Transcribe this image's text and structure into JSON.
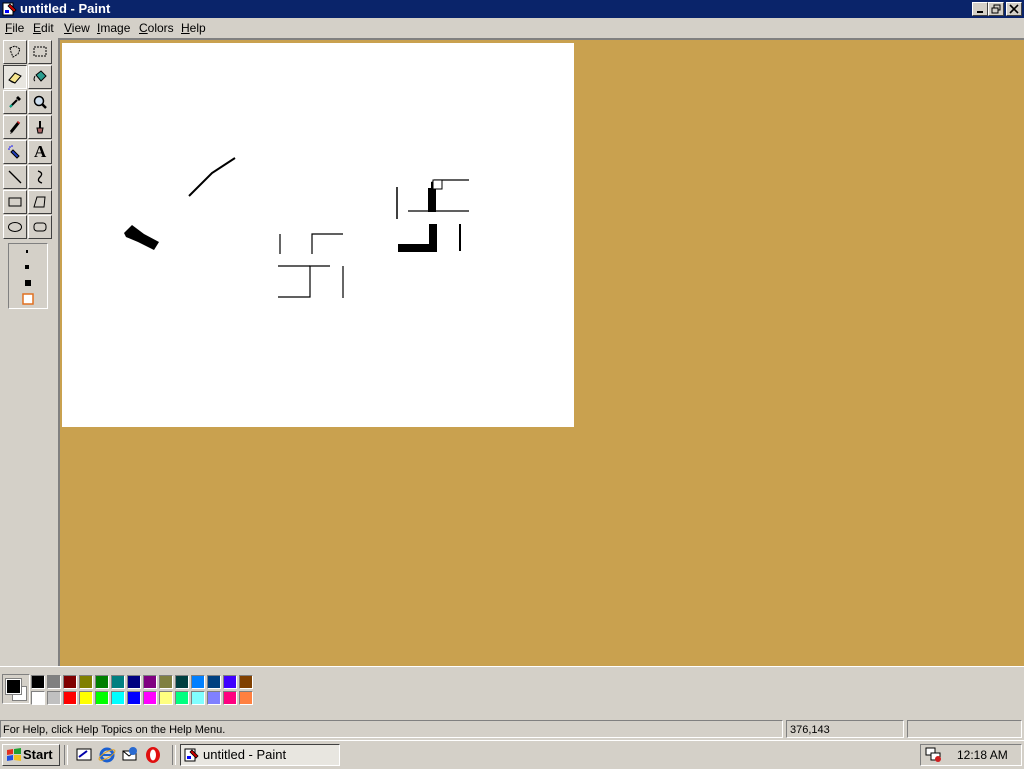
{
  "window": {
    "title": "untitled - Paint"
  },
  "menu": [
    {
      "label": "File"
    },
    {
      "label": "Edit"
    },
    {
      "label": "View"
    },
    {
      "label": "Image"
    },
    {
      "label": "Colors"
    },
    {
      "label": "Help"
    }
  ],
  "tools": [
    "free-form-select",
    "select",
    "eraser",
    "fill-with-color",
    "pick-color",
    "magnifier",
    "pencil",
    "brush",
    "airbrush",
    "text",
    "line",
    "curve",
    "rectangle",
    "polygon",
    "ellipse",
    "rounded-rectangle"
  ],
  "active_tool": "eraser",
  "text_tool_glyph": "A",
  "colors": {
    "workspace": "#c9a14f",
    "titlebar": "#0a246a",
    "foreground": "#000000",
    "background": "#ffffff",
    "palette_top": [
      "#000000",
      "#808080",
      "#800000",
      "#808000",
      "#008000",
      "#008080",
      "#000080",
      "#800080",
      "#808040",
      "#004040",
      "#0080ff",
      "#004080",
      "#4000ff",
      "#804000"
    ],
    "palette_bottom": [
      "#ffffff",
      "#c0c0c0",
      "#ff0000",
      "#ffff00",
      "#00ff00",
      "#00ffff",
      "#0000ff",
      "#ff00ff",
      "#ffff80",
      "#00ff80",
      "#80ffff",
      "#8080ff",
      "#ff0080",
      "#ff8040"
    ]
  },
  "status": {
    "help": "For Help, click Help Topics on the Help Menu.",
    "coords": "376,143",
    "size": ""
  },
  "taskbar": {
    "start_label": "Start",
    "task_label": "untitled - Paint",
    "clock": "12:18 AM"
  }
}
